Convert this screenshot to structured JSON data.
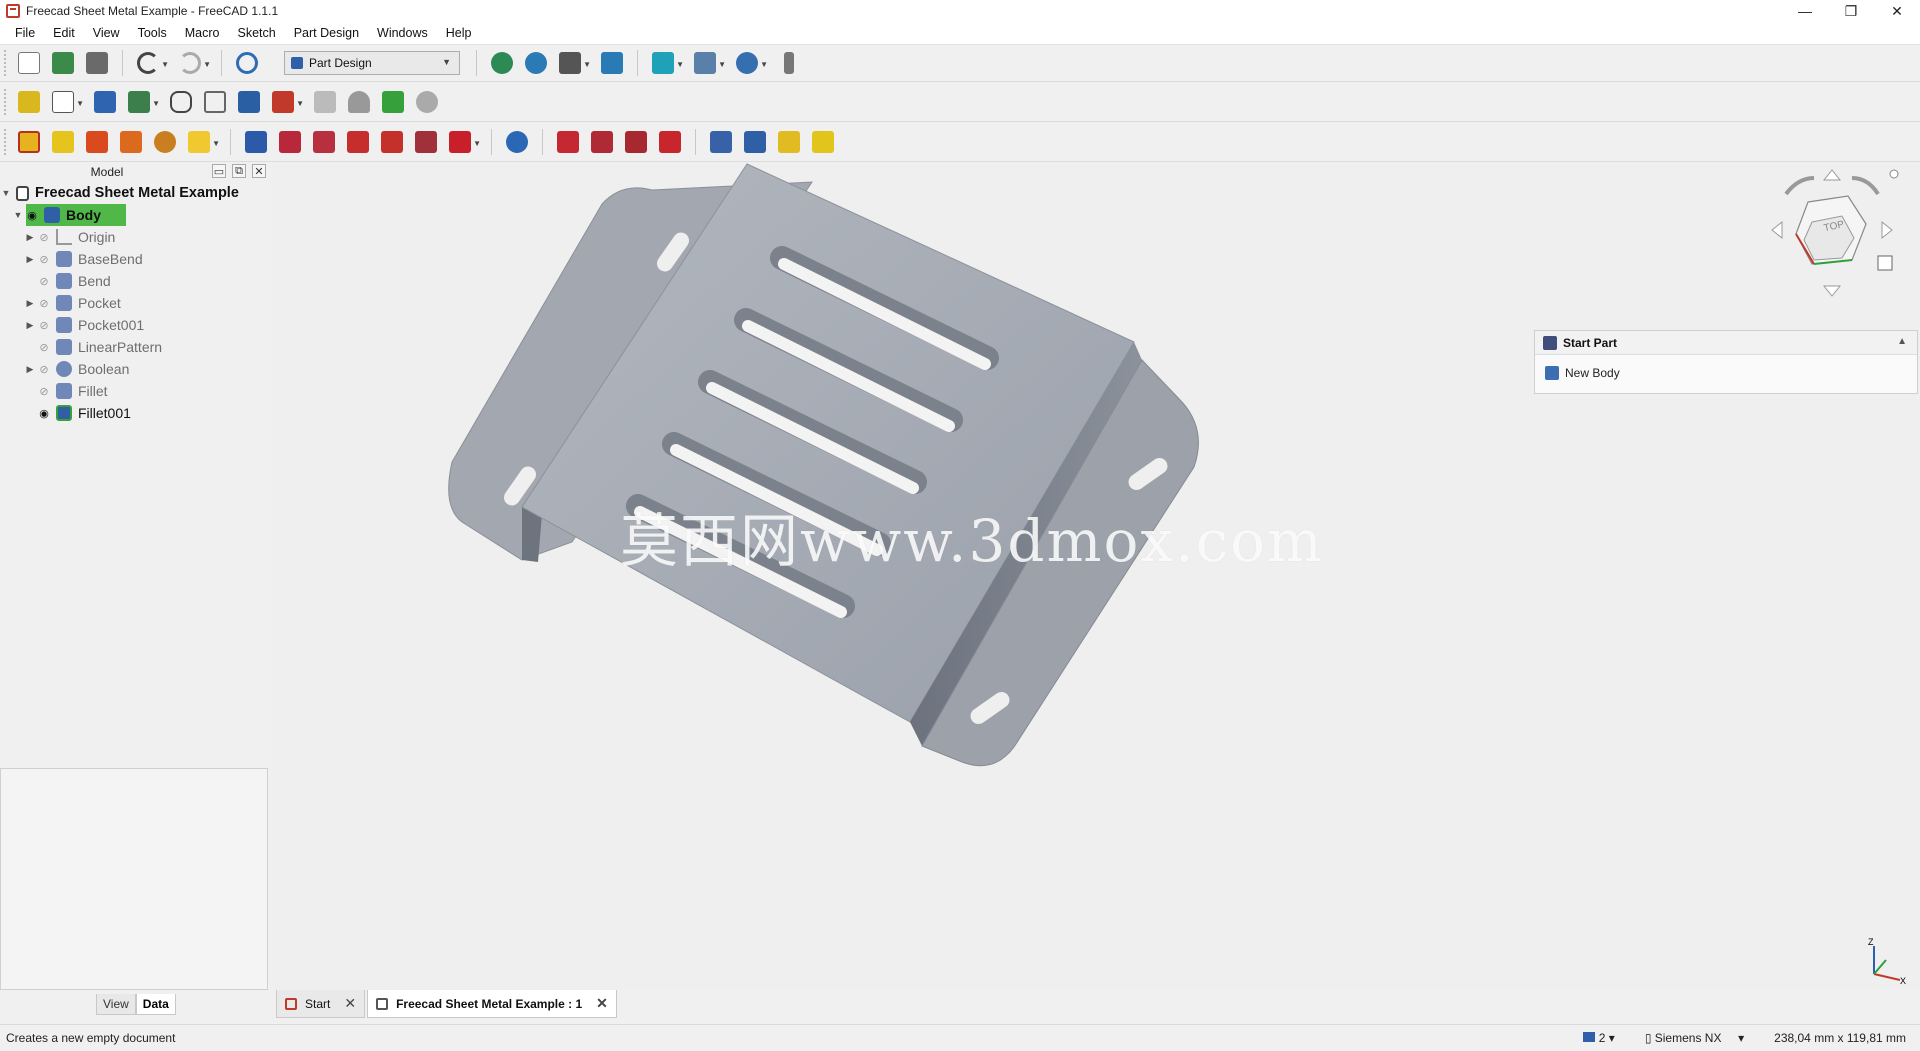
{
  "window": {
    "title": "Freecad Sheet Metal Example - FreeCAD 1.1.1",
    "controls": [
      "—",
      "❐",
      "✕"
    ]
  },
  "menu": [
    "File",
    "Edit",
    "View",
    "Tools",
    "Macro",
    "Sketch",
    "Part Design",
    "Windows",
    "Help"
  ],
  "toolbar": {
    "workbench": "Part Design"
  },
  "model_panel": {
    "title": "Model",
    "tree": {
      "root": "Freecad Sheet Metal Example",
      "body": "Body",
      "children": [
        {
          "label": "Origin",
          "expandable": true
        },
        {
          "label": "BaseBend",
          "expandable": true
        },
        {
          "label": "Bend",
          "expandable": false
        },
        {
          "label": "Pocket",
          "expandable": true
        },
        {
          "label": "Pocket001",
          "expandable": true
        },
        {
          "label": "LinearPattern",
          "expandable": false
        },
        {
          "label": "Boolean",
          "expandable": true
        },
        {
          "label": "Fillet",
          "expandable": false
        },
        {
          "label": "Fillet001",
          "expandable": false
        }
      ]
    },
    "tabs": [
      "View",
      "Data"
    ],
    "selected_tab": "Data"
  },
  "viewport": {
    "watermark": "莫西网www.3dmox.com",
    "navcube_face": "TOP",
    "axis": {
      "z": "Z",
      "x": "X"
    },
    "colors": {
      "background": "#efefef",
      "part": "#9ea4ae",
      "part_dark": "#757b86",
      "part_light": "#c3c7cf"
    }
  },
  "task_panel": {
    "header": "Start Part",
    "item": "New Body"
  },
  "doc_tabs": [
    {
      "label": "Start",
      "selected": false
    },
    {
      "label": "Freecad Sheet Metal Example : 1",
      "selected": true
    }
  ],
  "statusbar": {
    "message": "Creates a new empty document",
    "cache_count": "2",
    "nav_style": "Siemens NX",
    "dimensions": "238,04 mm x 119,81 mm"
  }
}
